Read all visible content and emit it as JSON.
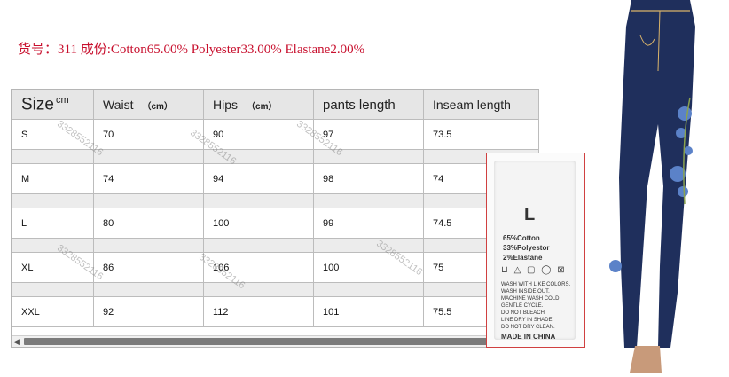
{
  "header": {
    "text": "货号：311 成份:Cotton65.00%  Polyester33.00%  Elastane2.00%"
  },
  "table": {
    "headers": {
      "size": "Size",
      "size_unit": "cm",
      "waist": "Waist",
      "waist_unit": "（cm）",
      "hips": "Hips",
      "hips_unit": "（cm）",
      "pants_length": "pants length",
      "inseam_length": "Inseam length"
    },
    "rows": [
      {
        "size": "S",
        "waist": "70",
        "hips": "90",
        "pants_length": "97",
        "inseam": "73.5"
      },
      {
        "size": "M",
        "waist": "74",
        "hips": "94",
        "pants_length": "98",
        "inseam": "74"
      },
      {
        "size": "L",
        "waist": "80",
        "hips": "100",
        "pants_length": "99",
        "inseam": "74.5"
      },
      {
        "size": "XL",
        "waist": "86",
        "hips": "106",
        "pants_length": "100",
        "inseam": "75"
      },
      {
        "size": "XXL",
        "waist": "92",
        "hips": "112",
        "pants_length": "101",
        "inseam": "75.5"
      }
    ]
  },
  "watermark": "3328552116",
  "care_label": {
    "size": "L",
    "fabric_lines": [
      "65%Cotton",
      "33%Polyestor",
      "2%Elastane"
    ],
    "care_text": "WASH WITH LIKE COLORS.\nWASH INSIDE OUT.\nMACHINE WASH COLD.\nGENTLE CYCLE.\nDO NOT BLEACH.\nLINE DRY IN SHADE.\nDO NOT DRY CLEAN.",
    "made_in": "MADE IN CHINA"
  },
  "colors": {
    "header_red": "#c8102e",
    "denim": "#1f2f5c",
    "embroidery": "#5b82c8"
  }
}
